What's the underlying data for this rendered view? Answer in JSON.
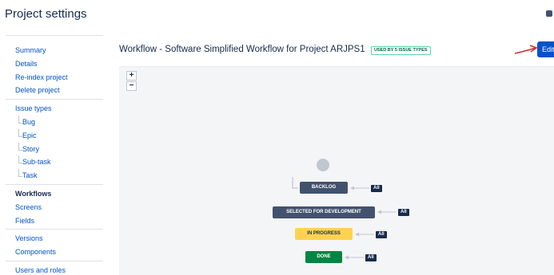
{
  "header": {
    "title": "Project settings"
  },
  "sidebar": {
    "group1": [
      "Summary",
      "Details",
      "Re-index project",
      "Delete project"
    ],
    "issue_types_label": "Issue types",
    "issue_types": [
      "Bug",
      "Epic",
      "Story",
      "Sub-task",
      "Task"
    ],
    "group3": [
      "Workflows",
      "Screens",
      "Fields"
    ],
    "group4": [
      "Versions",
      "Components"
    ],
    "group5": [
      "Users and roles"
    ]
  },
  "workflow": {
    "title": "Workflow - Software Simplified Workflow for Project ARJPS1",
    "used_badge": "USED BY 5 ISSUE TYPES",
    "edit_label": "Edit",
    "zoom_in": "+",
    "zoom_out": "−",
    "statuses": [
      {
        "label": "BACKLOG",
        "tag": "All",
        "color": "#42526e"
      },
      {
        "label": "SELECTED FOR DEVELOPMENT",
        "tag": "All",
        "color": "#42526e"
      },
      {
        "label": "IN PROGRESS",
        "tag": "All",
        "color": "#ffd351"
      },
      {
        "label": "DONE",
        "tag": "All",
        "color": "#008643"
      }
    ]
  },
  "colors": {
    "link": "#0052cc",
    "primary_button": "#0052cc",
    "annotation": "#d32f2f"
  }
}
